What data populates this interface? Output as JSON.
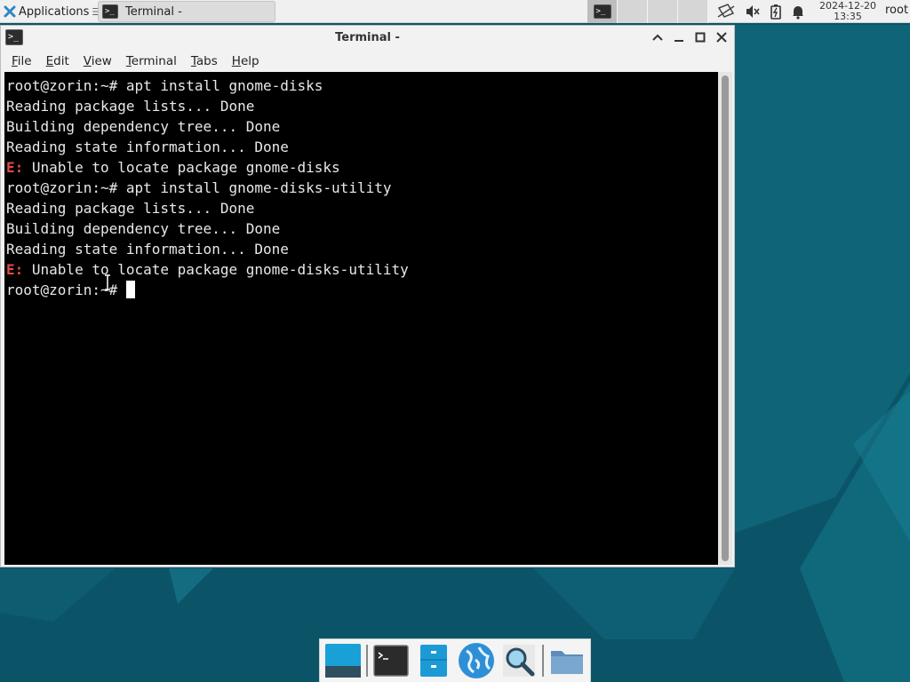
{
  "colors": {
    "desktop": "#0b5467",
    "terminal_bg": "#000000",
    "terminal_fg": "#e8e8e8",
    "error_prefix": "#e04a4a"
  },
  "top_panel": {
    "apps_label": "Applications",
    "taskbar_item": "Terminal -",
    "clock_date": "2024-12-20",
    "clock_time": "13:35",
    "user": "root",
    "tray_icons": [
      "network-icon",
      "volume-muted-icon",
      "battery-icon",
      "notification-bell-icon"
    ]
  },
  "window": {
    "title": "Terminal -",
    "menu": [
      "File",
      "Edit",
      "View",
      "Terminal",
      "Tabs",
      "Help"
    ]
  },
  "terminal": {
    "lines": [
      {
        "prefix": "",
        "text": "root@zorin:~# apt install gnome-disks"
      },
      {
        "prefix": "",
        "text": "Reading package lists... Done"
      },
      {
        "prefix": "",
        "text": "Building dependency tree... Done"
      },
      {
        "prefix": "",
        "text": "Reading state information... Done"
      },
      {
        "prefix": "E:",
        "text": " Unable to locate package gnome-disks"
      },
      {
        "prefix": "",
        "text": "root@zorin:~# apt install gnome-disks-utility"
      },
      {
        "prefix": "",
        "text": "Reading package lists... Done"
      },
      {
        "prefix": "",
        "text": "Building dependency tree... Done"
      },
      {
        "prefix": "",
        "text": "Reading state information... Done"
      },
      {
        "prefix": "E:",
        "text": " Unable to locate package gnome-disks-utility"
      }
    ],
    "prompt": "root@zorin:~# "
  },
  "dock": {
    "items": [
      "show-desktop-icon",
      "terminal-icon",
      "file-manager-icon",
      "web-browser-icon",
      "search-icon",
      "folder-icon"
    ]
  }
}
